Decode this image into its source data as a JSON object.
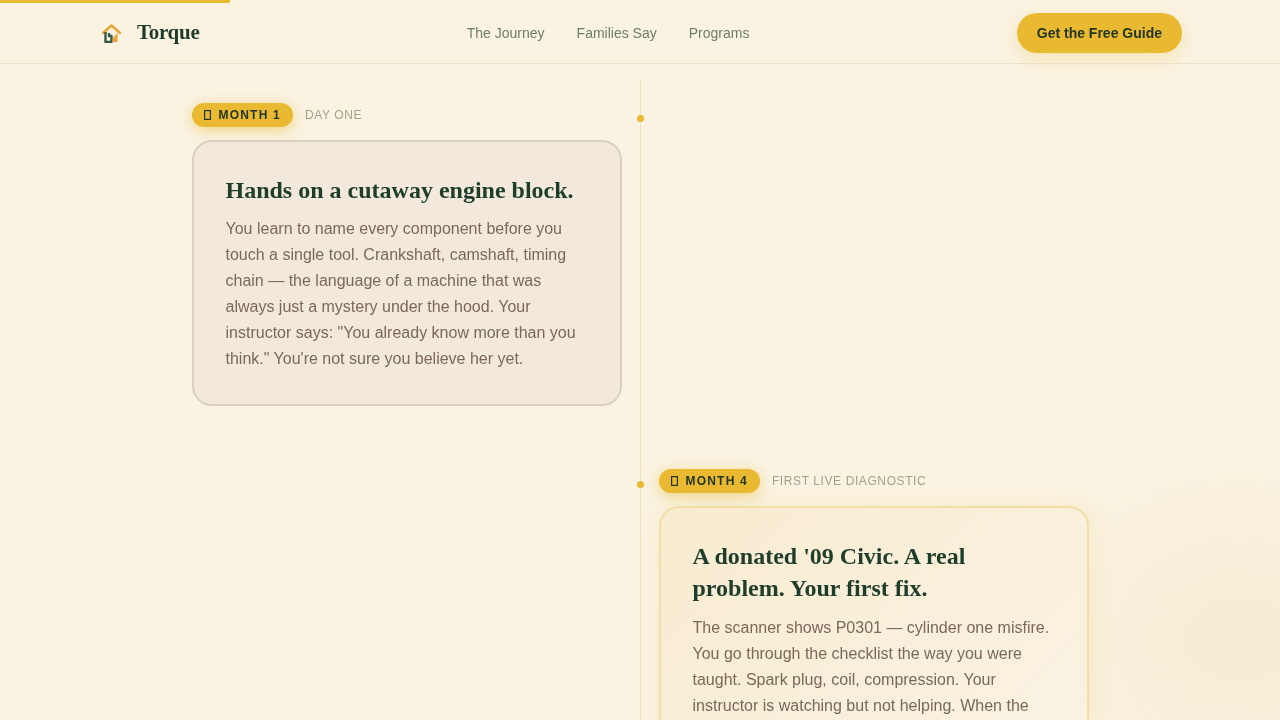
{
  "progress": {
    "level": 0.18
  },
  "header": {
    "brand": "Torque",
    "nav": [
      "The Journey",
      "Families Say",
      "Programs"
    ],
    "cta": "Get the Free Guide"
  },
  "timeline": [
    {
      "badge": "MONTH 1",
      "label": "DAY ONE",
      "title": "Hands on a cutaway engine block.",
      "body": "You learn to name every component before you touch a single tool. Crankshaft, camshaft, timing chain — the language of a machine that was always just a mystery under the hood. Your instructor says: \"You already know more than you think.\" You're not sure you believe her yet.",
      "highlighted": false
    },
    {
      "badge": "MONTH 4",
      "label": "FIRST LIVE DIAGNOSTIC",
      "title": "A donated '09 Civic. A real problem. Your first fix.",
      "body": "The scanner shows P0301 — cylinder one misfire. You go through the checklist the way you were taught. Spark plug, coil, compression. Your instructor is watching but not helping. When the",
      "highlighted": true
    }
  ]
}
